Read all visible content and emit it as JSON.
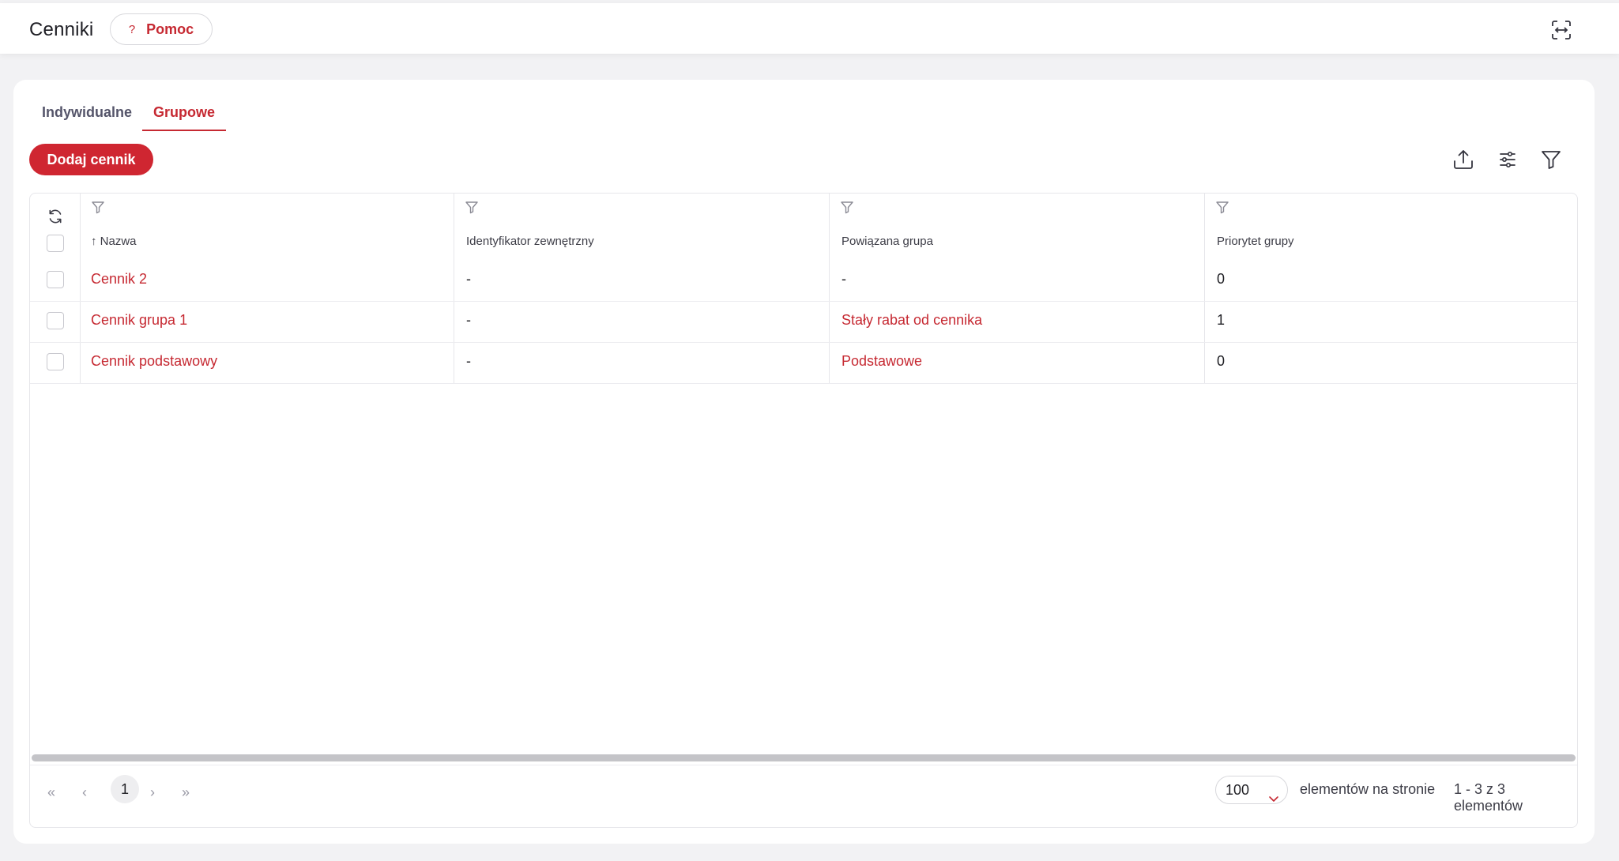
{
  "header": {
    "title": "Cenniki",
    "help_label": "Pomoc",
    "help_mark": "?"
  },
  "tabs": [
    {
      "label": "Indywidualne",
      "active": false
    },
    {
      "label": "Grupowe",
      "active": true
    }
  ],
  "toolbar": {
    "add_label": "Dodaj cennik",
    "icons": [
      "export-icon",
      "settings-sliders-icon",
      "filter-icon"
    ]
  },
  "table": {
    "columns": [
      {
        "label": "Nazwa",
        "sorted": "asc"
      },
      {
        "label": "Identyfikator zewnętrzny"
      },
      {
        "label": "Powiązana grupa"
      },
      {
        "label": "Priorytet grupy"
      }
    ],
    "rows": [
      {
        "name": "Cennik 2",
        "external_id": "-",
        "group": "-",
        "priority": "0",
        "group_is_link": false
      },
      {
        "name": "Cennik grupa 1",
        "external_id": "-",
        "group": "Stały rabat od cennika",
        "priority": "1",
        "group_is_link": true
      },
      {
        "name": "Cennik podstawowy",
        "external_id": "-",
        "group": "Podstawowe",
        "priority": "0",
        "group_is_link": true
      }
    ]
  },
  "pagination": {
    "current_page": "1",
    "page_size": "100",
    "page_size_label": "elementów na stronie",
    "range_label": "1 - 3 z 3 elementów"
  },
  "colors": {
    "accent": "#c62932",
    "button": "#cf2631",
    "background": "#f2f2f4"
  }
}
